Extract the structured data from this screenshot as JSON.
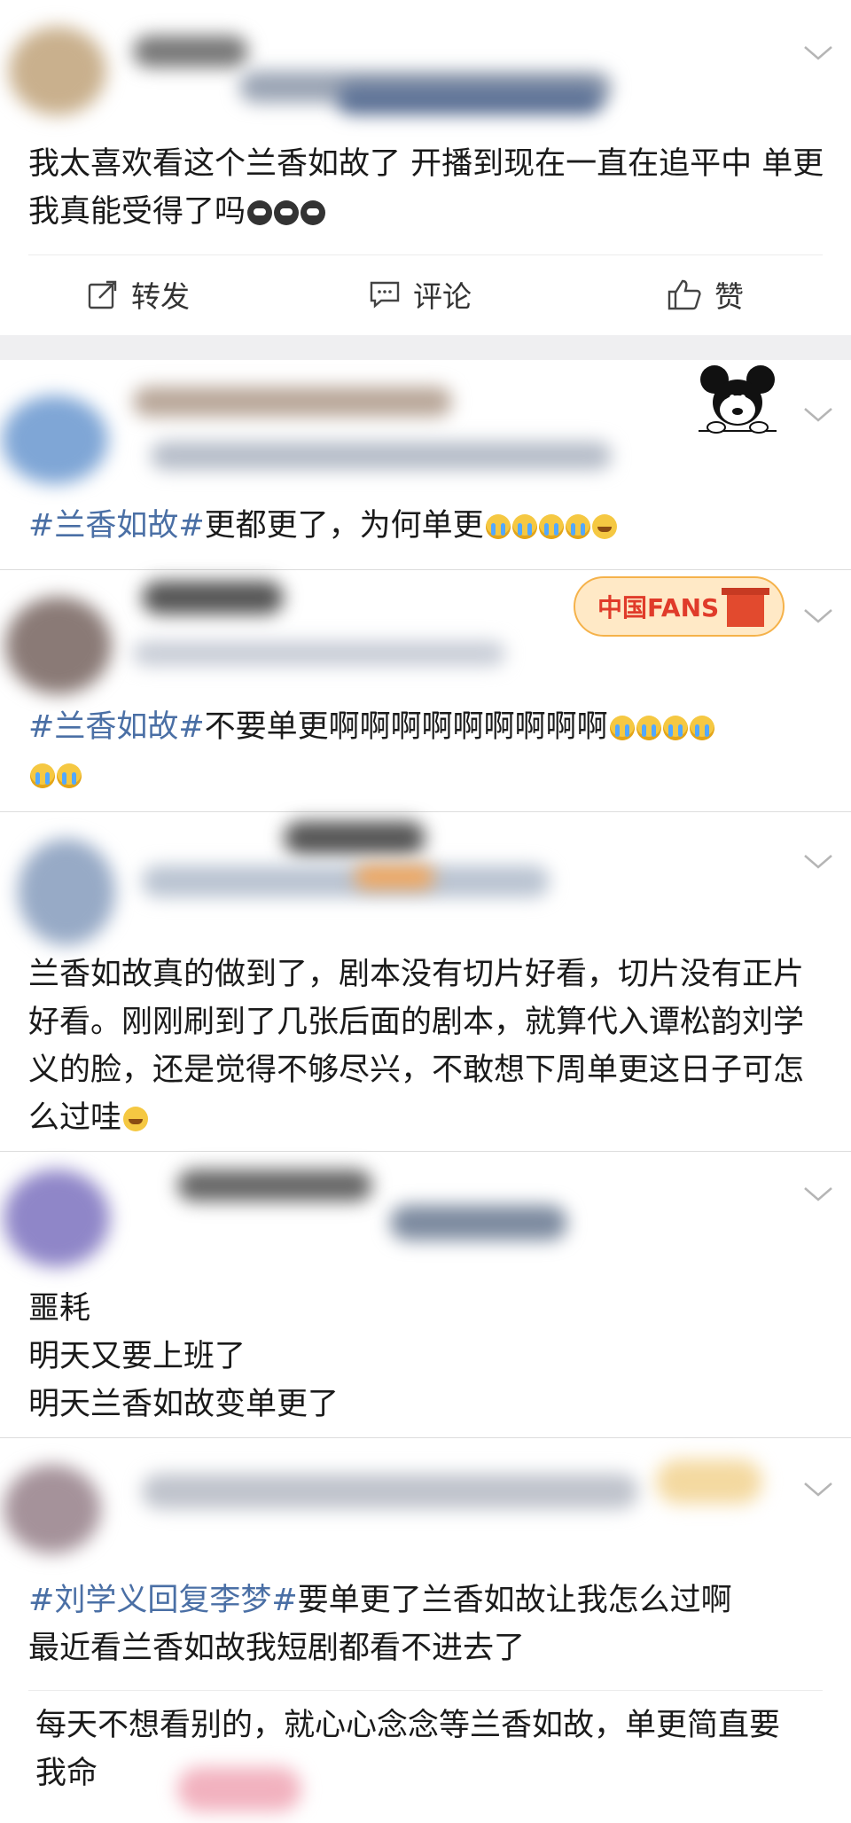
{
  "posts": [
    {
      "text": "我太喜欢看这个兰香如故了 开播到现在一直在追平中 单更我真能受得了吗",
      "emojis": [
        "dark-teary-icon",
        "dark-teary-icon",
        "dark-teary-icon"
      ]
    },
    {
      "tag": "#兰香如故#",
      "text": "更都更了，为何单更",
      "emojis": [
        "crying-icon",
        "crying-icon",
        "crying-icon",
        "crying-icon",
        "pleading-icon"
      ]
    },
    {
      "tag": "#兰香如故#",
      "text": "不要单更啊啊啊啊啊啊啊啊啊",
      "emojis": [
        "crying-icon",
        "crying-icon",
        "crying-icon",
        "crying-icon",
        "crying-icon",
        "crying-icon"
      ],
      "badge_text": "中国FANS"
    },
    {
      "text": "兰香如故真的做到了，剧本没有切片好看，切片没有正片好看。刚刚刷到了几张后面的剧本，就算代入谭松韵刘学义的脸，还是觉得不够尽兴，不敢想下周单更这日子可怎么过哇",
      "emojis": [
        "pleading-icon"
      ]
    },
    {
      "lines": [
        "噩耗",
        "明天又要上班了",
        "明天兰香如故变单更了"
      ]
    },
    {
      "tag": "#刘学义回复李梦#",
      "text": "要单更了兰香如故让我怎么过啊",
      "line2": "最近看兰香如故我短剧都看不进去了"
    },
    {
      "text": "每天不想看别的，就心心念念等兰香如故，单更简直要我命"
    }
  ],
  "actions": {
    "repost": "转发",
    "comment": "评论",
    "like": "赞"
  },
  "colors": {
    "tag": "#4a6fa5",
    "separator": "#efeff1"
  }
}
